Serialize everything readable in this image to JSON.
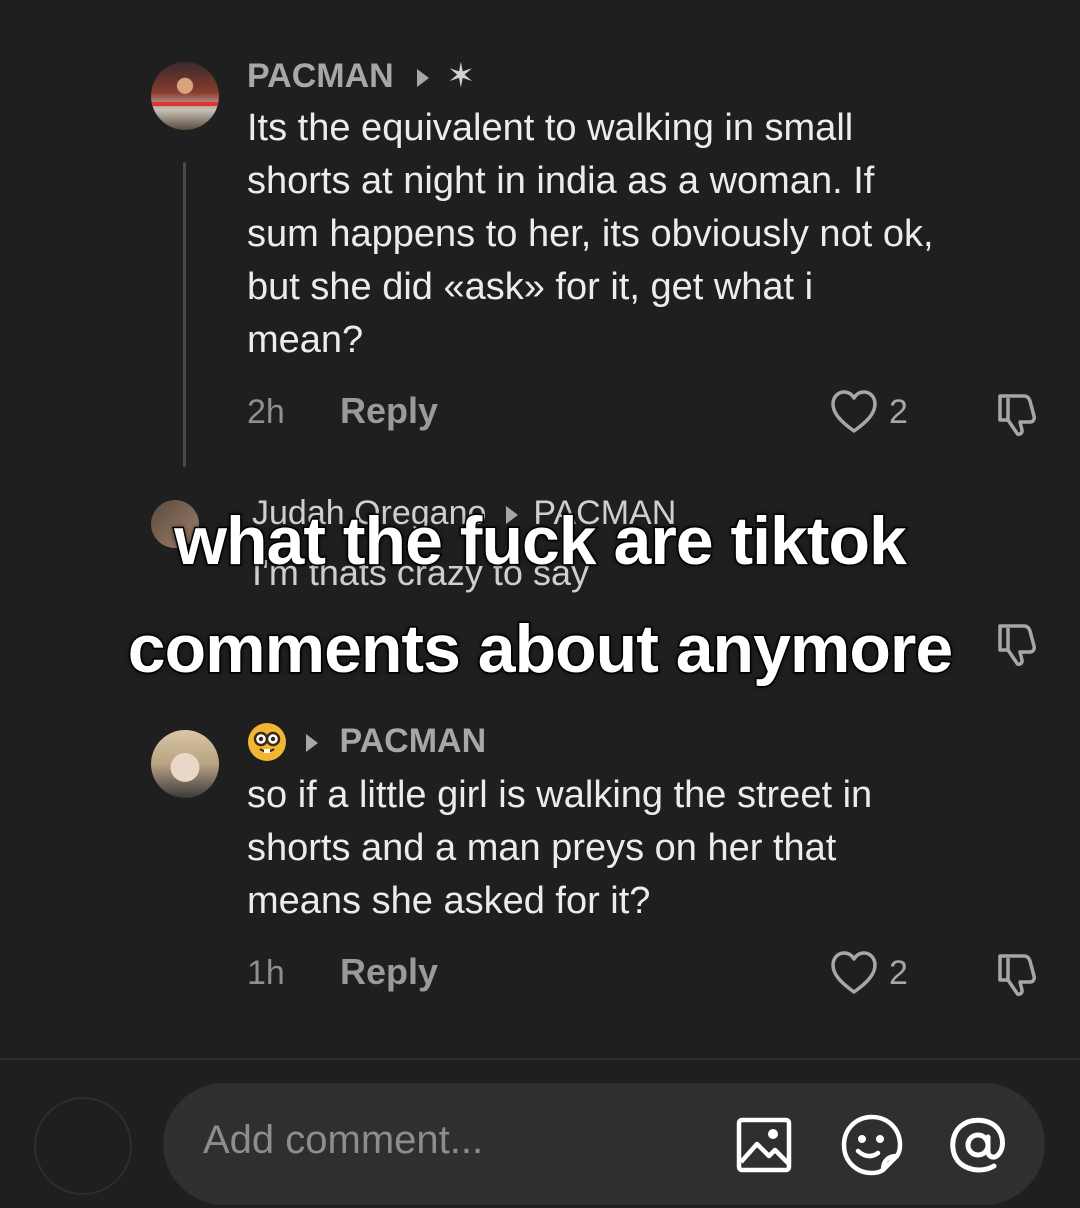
{
  "comments": [
    {
      "username": "PACMAN",
      "badge": "✶",
      "text": "Its the equivalent to walking in small\nshorts at night in india as a woman. If\nsum happens to her, its obviously not ok,\nbut she did «ask» for it, get what i\nmean?",
      "time": "2h",
      "reply_label": "Reply",
      "likes": "2"
    },
    {
      "username": "Judah Oregano",
      "reply_to": "PACMAN",
      "text": "I'm thats crazy to say"
    },
    {
      "username": "",
      "avatar_emoji": "nerd-face",
      "reply_to": "PACMAN",
      "text": "so if a little girl is walking the street in\nshorts and a man preys on her that\nmeans she asked for it?",
      "time": "1h",
      "reply_label": "Reply",
      "likes": "2"
    }
  ],
  "overlay": {
    "line1": "what the fuck are tiktok",
    "line2": "comments about anymore"
  },
  "composer": {
    "placeholder": "Add comment..."
  },
  "icons": {
    "like": "heart-outline-icon",
    "dislike": "thumbs-down-icon",
    "image": "image-icon",
    "emoji": "emoji-sticker-icon",
    "mention": "at-mention-icon"
  }
}
